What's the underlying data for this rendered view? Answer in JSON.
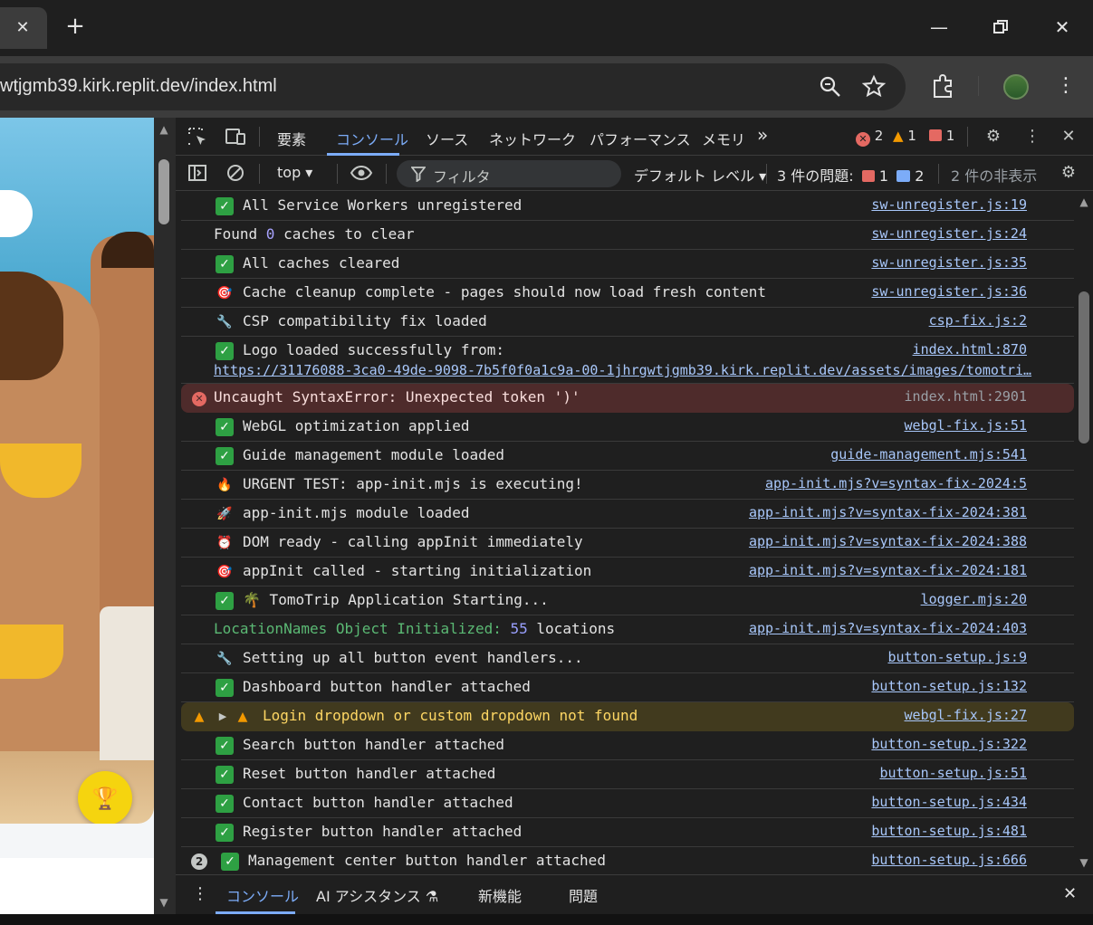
{
  "browser": {
    "url": "wtjgmb39.kirk.replit.dev/index.html"
  },
  "devtools": {
    "tabs": [
      "要素",
      "コンソール",
      "ソース",
      "ネットワーク",
      "パフォーマンス",
      "メモリ"
    ],
    "more_tabs": "»",
    "counts": {
      "errors": "2",
      "warnings": "1",
      "issues": "1"
    },
    "toolbar": {
      "context": "top",
      "filter_placeholder": "フィルタ",
      "levels": "デフォルト レベル",
      "issues_label": "3 件の問題:",
      "issues_red": "1",
      "issues_blue": "2",
      "hidden": "2 件の非表示"
    },
    "console": [
      {
        "icon": "check",
        "text": "All Service Workers unregistered",
        "src": "sw-unregister.js:19"
      },
      {
        "icon": "",
        "prefix": "Found ",
        "num": "0",
        "suffix": " caches to clear",
        "src": "sw-unregister.js:24"
      },
      {
        "icon": "check",
        "text": "All caches cleared",
        "src": "sw-unregister.js:35"
      },
      {
        "icon": "target",
        "text": "Cache cleanup complete - pages should now load fresh content",
        "src": "sw-unregister.js:36"
      },
      {
        "icon": "wrench",
        "text": "CSP compatibility fix loaded",
        "src": "csp-fix.js:2"
      },
      {
        "icon": "check",
        "text": "Logo loaded successfully from:",
        "src": "index.html:870",
        "link": "https://31176088-3ca0-49de-9098-7b5f0f0a1c9a-00-1jhrgwtjgmb39.kirk.replit.dev/assets/images/tomotri…"
      },
      {
        "icon": "error",
        "text": "Uncaught SyntaxError: Unexpected token ')'",
        "src": "index.html:2901"
      },
      {
        "icon": "check",
        "text": "WebGL optimization applied",
        "src": "webgl-fix.js:51"
      },
      {
        "icon": "check",
        "text": "Guide management module loaded",
        "src": "guide-management.mjs:541"
      },
      {
        "icon": "fire",
        "text": "URGENT TEST: app-init.mjs is executing!",
        "src": "app-init.mjs?v=syntax-fix-2024:5"
      },
      {
        "icon": "rocket",
        "text": "app-init.mjs module loaded",
        "src": "app-init.mjs?v=syntax-fix-2024:381"
      },
      {
        "icon": "alarm",
        "text": "DOM ready - calling appInit immediately",
        "src": "app-init.mjs?v=syntax-fix-2024:388"
      },
      {
        "icon": "target",
        "text": "appInit called - starting initialization",
        "src": "app-init.mjs?v=syntax-fix-2024:181"
      },
      {
        "icon": "check",
        "text": "🌴 TomoTrip Application Starting...",
        "src": "logger.mjs:20"
      },
      {
        "icon": "",
        "green": "LocationNames Object Initialized: ",
        "num": "55",
        "suffix": " locations",
        "src": "app-init.mjs?v=syntax-fix-2024:403"
      },
      {
        "icon": "wrench",
        "text": "Setting up all button event handlers...",
        "src": "button-setup.js:9"
      },
      {
        "icon": "check",
        "text": "Dashboard button handler attached",
        "src": "button-setup.js:132"
      },
      {
        "icon": "warn",
        "text": "Login dropdown or custom dropdown not found",
        "src": "webgl-fix.js:27"
      },
      {
        "icon": "check",
        "text": "Search button handler attached",
        "src": "button-setup.js:322"
      },
      {
        "icon": "check",
        "text": "Reset button handler attached",
        "src": "button-setup.js:51"
      },
      {
        "icon": "check",
        "text": "Contact button handler attached",
        "src": "button-setup.js:434"
      },
      {
        "icon": "check",
        "text": "Register button handler attached",
        "src": "button-setup.js:481"
      },
      {
        "icon": "check",
        "repeat": "2",
        "text": "Management center button handler attached",
        "src": "button-setup.js:666"
      }
    ],
    "drawer": [
      "コンソール",
      "AI アシスタンス",
      "新機能",
      "問題"
    ]
  }
}
